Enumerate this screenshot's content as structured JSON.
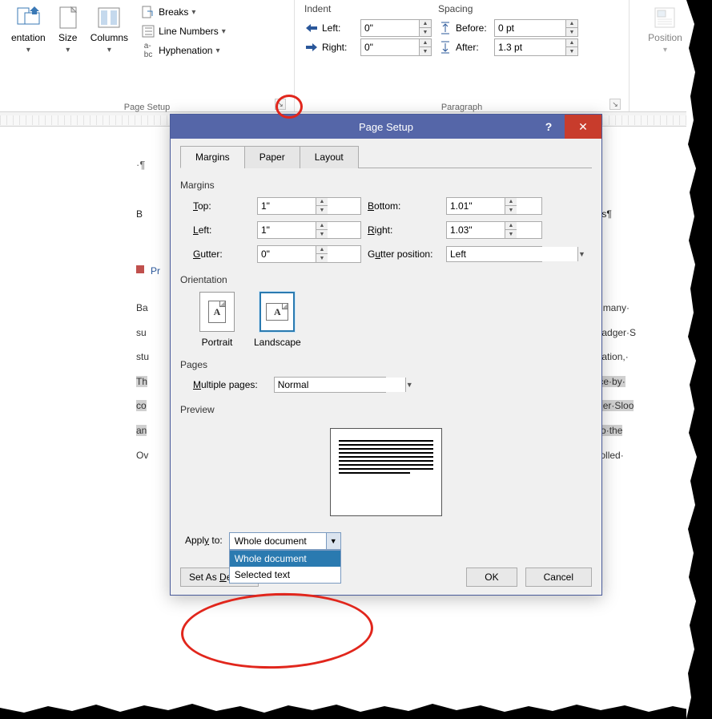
{
  "ribbon": {
    "orientation": {
      "label": "entation",
      "dd": "▾"
    },
    "size": {
      "label": "Size",
      "dd": "▾"
    },
    "columns": {
      "label": "Columns",
      "dd": "▾"
    },
    "breaks": {
      "label": "Breaks",
      "dd": "▾"
    },
    "line_numbers": {
      "label": "Line Numbers",
      "dd": "▾"
    },
    "hyphenation": {
      "label": "Hyphenation",
      "dd": "▾"
    },
    "page_setup_label": "Page Setup",
    "indent_header": "Indent",
    "spacing_header": "Spacing",
    "indent_left_label": "Left:",
    "indent_left_value": "0\"",
    "indent_right_label": "Right:",
    "indent_right_value": "0\"",
    "spacing_before_label": "Before:",
    "spacing_before_value": "0 pt",
    "spacing_after_label": "After:",
    "spacing_after_value": "1.3 pt",
    "paragraph_label": "Paragraph",
    "position_label": "Position"
  },
  "document": {
    "title_fragment_left": "B",
    "title_fragment_right": "ous¶",
    "heading2": "Pr",
    "line1_left": "Ba",
    "line1_right": "for·many·",
    "line2_left": "su",
    "line2_right": "n·Badger·S",
    "line3_left": "stu",
    "line3_right": "nication,·",
    "line4_left": "Th",
    "line4_right": "ence·by·",
    "line5_left": "co",
    "line5_right": "adger·Sloo",
    "line6_left": "an",
    "line6_right": "le·to·the",
    "line7_left": "Ov",
    "line7_right": "ntrolled·"
  },
  "dialog": {
    "title": "Page Setup",
    "help": "?",
    "close": "✕",
    "tabs": {
      "margins": "Margins",
      "paper": "Paper",
      "layout": "Layout"
    },
    "margins_section": "Margins",
    "top_label": "Top:",
    "top_value": "1\"",
    "bottom_label": "Bottom:",
    "bottom_value": "1.01\"",
    "left_label": "Left:",
    "left_value": "1\"",
    "right_label": "Right:",
    "right_value": "1.03\"",
    "gutter_label": "Gutter:",
    "gutter_value": "0\"",
    "gutter_pos_label": "Gutter position:",
    "gutter_pos_value": "Left",
    "orientation_section": "Orientation",
    "portrait_label": "Portrait",
    "landscape_label": "Landscape",
    "pages_section": "Pages",
    "multiple_pages_label": "Multiple pages:",
    "multiple_pages_value": "Normal",
    "preview_section": "Preview",
    "apply_to_label": "Apply to:",
    "apply_to_value": "Whole document",
    "apply_to_options": {
      "opt1": "Whole document",
      "opt2": "Selected text"
    },
    "set_default": "Set As Default",
    "ok": "OK",
    "cancel": "Cancel"
  }
}
